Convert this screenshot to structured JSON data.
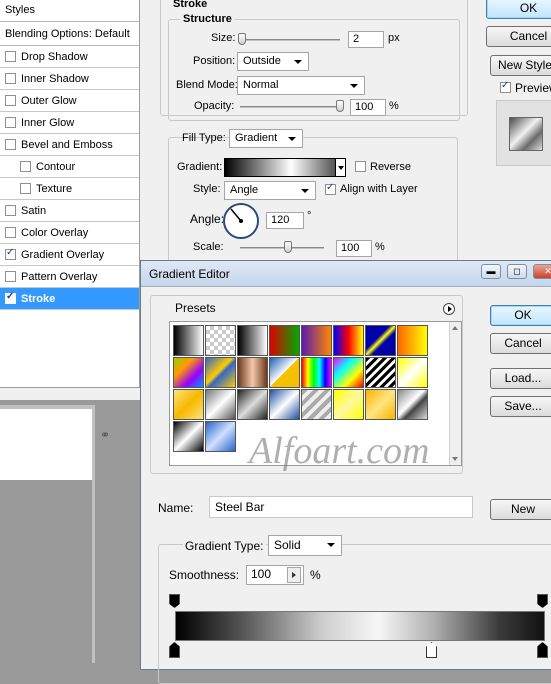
{
  "layer_style": {
    "styles_header": "Styles",
    "blending_options": "Blending Options: Default",
    "style_items": [
      {
        "label": "Drop Shadow",
        "checked": false
      },
      {
        "label": "Inner Shadow",
        "checked": false
      },
      {
        "label": "Outer Glow",
        "checked": false
      },
      {
        "label": "Inner Glow",
        "checked": false
      },
      {
        "label": "Bevel and Emboss",
        "checked": false
      },
      {
        "label": "Contour",
        "checked": false
      },
      {
        "label": "Texture",
        "checked": false
      },
      {
        "label": "Satin",
        "checked": false
      },
      {
        "label": "Color Overlay",
        "checked": false
      },
      {
        "label": "Gradient Overlay",
        "checked": true
      },
      {
        "label": "Pattern Overlay",
        "checked": false
      },
      {
        "label": "Stroke",
        "checked": true
      }
    ],
    "stroke_title": "Stroke",
    "structure_title": "Structure",
    "size_label": "Size:",
    "size_value": "2",
    "size_unit": "px",
    "position_label": "Position:",
    "position_value": "Outside",
    "blend_mode_label": "Blend Mode:",
    "blend_mode_value": "Normal",
    "opacity_label": "Opacity:",
    "opacity_value": "100",
    "opacity_unit": "%",
    "fill_type_label": "Fill Type:",
    "fill_type_value": "Gradient",
    "gradient_label": "Gradient:",
    "reverse_label": "Reverse",
    "reverse_checked": false,
    "style_label": "Style:",
    "style_value": "Angle",
    "align_label": "Align with Layer",
    "align_checked": true,
    "angle_label": "Angle:",
    "angle_value": "120",
    "angle_unit": "°",
    "scale_label": "Scale:",
    "scale_value": "100",
    "scale_unit": "%",
    "ok_label": "OK",
    "cancel_label": "Cancel",
    "new_style_label": "New Style...",
    "preview_label": "Preview",
    "preview_checked": true
  },
  "gradient_editor": {
    "title": "Gradient Editor",
    "presets_label": "Presets",
    "ok_label": "OK",
    "cancel_label": "Cancel",
    "load_label": "Load...",
    "save_label": "Save...",
    "name_label": "Name:",
    "name_value": "Steel Bar",
    "new_label": "New",
    "gradient_type_label": "Gradient Type:",
    "gradient_type_value": "Solid",
    "smoothness_label": "Smoothness:",
    "smoothness_value": "100",
    "smoothness_unit": "%",
    "watermark": "Alfoart.com"
  }
}
